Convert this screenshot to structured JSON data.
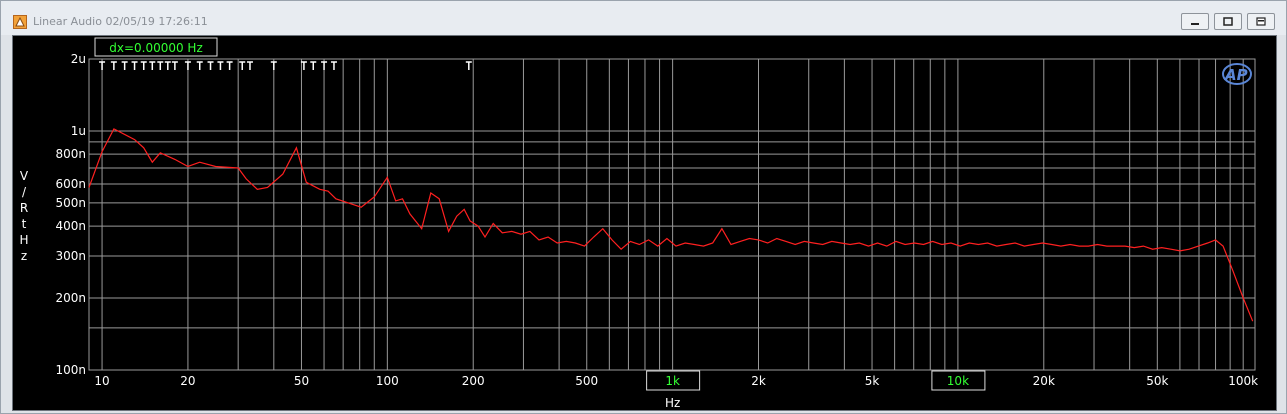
{
  "window": {
    "title": "Linear Audio  02/05/19 17:26:11",
    "minimize_label": "",
    "maximize_label": "",
    "close_label": ""
  },
  "cursor_readout": "dx=0.00000  Hz",
  "icons": [
    "app-icon",
    "ap-logo-icon",
    "minimize-icon",
    "maximize-icon",
    "close-icon"
  ],
  "colors": {
    "trace": "#ff2020",
    "grid": "#9a9a9a",
    "background": "#000000",
    "highlight_tick": "#33ff33"
  },
  "chart_data": {
    "type": "line",
    "title": "",
    "xlabel": "Hz",
    "ylabel": "V/RtHz",
    "xscale": "log",
    "yscale": "log",
    "xlim": [
      9,
      110000
    ],
    "ylim": [
      1e-07,
      2e-06
    ],
    "grid": true,
    "x_ticks": [
      {
        "v": 10,
        "label": "10"
      },
      {
        "v": 20,
        "label": "20"
      },
      {
        "v": 50,
        "label": "50"
      },
      {
        "v": 100,
        "label": "100"
      },
      {
        "v": 200,
        "label": "200"
      },
      {
        "v": 500,
        "label": "500"
      },
      {
        "v": 1000,
        "label": "1k",
        "highlight": true
      },
      {
        "v": 2000,
        "label": "2k"
      },
      {
        "v": 5000,
        "label": "5k"
      },
      {
        "v": 10000,
        "label": "10k",
        "highlight": true
      },
      {
        "v": 20000,
        "label": "20k"
      },
      {
        "v": 50000,
        "label": "50k"
      },
      {
        "v": 100000,
        "label": "100k"
      }
    ],
    "y_ticks": [
      {
        "v": 2e-06,
        "label": "2u"
      },
      {
        "v": 1e-06,
        "label": "1u"
      },
      {
        "v": 8e-07,
        "label": "800n"
      },
      {
        "v": 6e-07,
        "label": "600n"
      },
      {
        "v": 5e-07,
        "label": "500n"
      },
      {
        "v": 4e-07,
        "label": "400n"
      },
      {
        "v": 3e-07,
        "label": "300n"
      },
      {
        "v": 2e-07,
        "label": "200n"
      },
      {
        "v": 1e-07,
        "label": "100n"
      }
    ],
    "markers_x": [
      10,
      11,
      12,
      13,
      14,
      15,
      16,
      17,
      18,
      20,
      22,
      24,
      26,
      28,
      31,
      33,
      40,
      51,
      55,
      60,
      65,
      193
    ],
    "series": [
      {
        "color": "#ff2020",
        "x": [
          9,
          10,
          11,
          13,
          14,
          15,
          16,
          18,
          20,
          22,
          25,
          30,
          32,
          35,
          38,
          43,
          48,
          52,
          58,
          62,
          66,
          73,
          81,
          90,
          100,
          107,
          113,
          120,
          132,
          142,
          152,
          164,
          175,
          186,
          195,
          208,
          220,
          235,
          253,
          273,
          294,
          316,
          340,
          366,
          394,
          424,
          456,
          491,
          529,
          569,
          613,
          660,
          711,
          765,
          824,
          887,
          955,
          1028,
          1107,
          1192,
          1283,
          1382,
          1488,
          1602,
          1725,
          1858,
          2000,
          2154,
          2319,
          2497,
          2689,
          2895,
          3117,
          3357,
          3614,
          3892,
          4190,
          4512,
          4859,
          5232,
          5633,
          6066,
          6531,
          7033,
          7573,
          8154,
          8780,
          9454,
          10180,
          10962,
          11803,
          12710,
          13686,
          14737,
          15868,
          17087,
          18398,
          19811,
          21332,
          22970,
          24733,
          26632,
          28677,
          30879,
          33249,
          35802,
          38551,
          41510,
          44697,
          48128,
          51823,
          55802,
          60086,
          64699,
          69666,
          75014,
          80000,
          85000,
          92000,
          100000,
          108000
        ],
        "y": [
          5.8e-07,
          8.2e-07,
          1.02e-06,
          9.2e-07,
          8.5e-07,
          7.4e-07,
          8.1e-07,
          7.6e-07,
          7.1e-07,
          7.4e-07,
          7.1e-07,
          7e-07,
          6.3e-07,
          5.7e-07,
          5.8e-07,
          6.6e-07,
          8.5e-07,
          6.1e-07,
          5.7e-07,
          5.6e-07,
          5.2e-07,
          5e-07,
          4.8e-07,
          5.3e-07,
          6.4e-07,
          5.1e-07,
          5.2e-07,
          4.5e-07,
          3.9e-07,
          5.5e-07,
          5.2e-07,
          3.8e-07,
          4.4e-07,
          4.7e-07,
          4.2e-07,
          4e-07,
          3.6e-07,
          4.1e-07,
          3.75e-07,
          3.8e-07,
          3.7e-07,
          3.8e-07,
          3.5e-07,
          3.6e-07,
          3.4e-07,
          3.45e-07,
          3.4e-07,
          3.3e-07,
          3.6e-07,
          3.9e-07,
          3.5e-07,
          3.2e-07,
          3.45e-07,
          3.35e-07,
          3.5e-07,
          3.3e-07,
          3.55e-07,
          3.3e-07,
          3.4e-07,
          3.35e-07,
          3.3e-07,
          3.4e-07,
          3.9e-07,
          3.35e-07,
          3.45e-07,
          3.55e-07,
          3.5e-07,
          3.4e-07,
          3.55e-07,
          3.45e-07,
          3.35e-07,
          3.45e-07,
          3.4e-07,
          3.35e-07,
          3.45e-07,
          3.4e-07,
          3.35e-07,
          3.4e-07,
          3.3e-07,
          3.4e-07,
          3.3e-07,
          3.45e-07,
          3.35e-07,
          3.4e-07,
          3.35e-07,
          3.45e-07,
          3.35e-07,
          3.4e-07,
          3.3e-07,
          3.4e-07,
          3.35e-07,
          3.4e-07,
          3.3e-07,
          3.35e-07,
          3.4e-07,
          3.3e-07,
          3.35e-07,
          3.4e-07,
          3.35e-07,
          3.3e-07,
          3.35e-07,
          3.3e-07,
          3.3e-07,
          3.35e-07,
          3.3e-07,
          3.3e-07,
          3.3e-07,
          3.25e-07,
          3.3e-07,
          3.2e-07,
          3.25e-07,
          3.2e-07,
          3.15e-07,
          3.2e-07,
          3.3e-07,
          3.4e-07,
          3.5e-07,
          3.3e-07,
          2.6e-07,
          2e-07,
          1.6e-07
        ]
      }
    ]
  }
}
